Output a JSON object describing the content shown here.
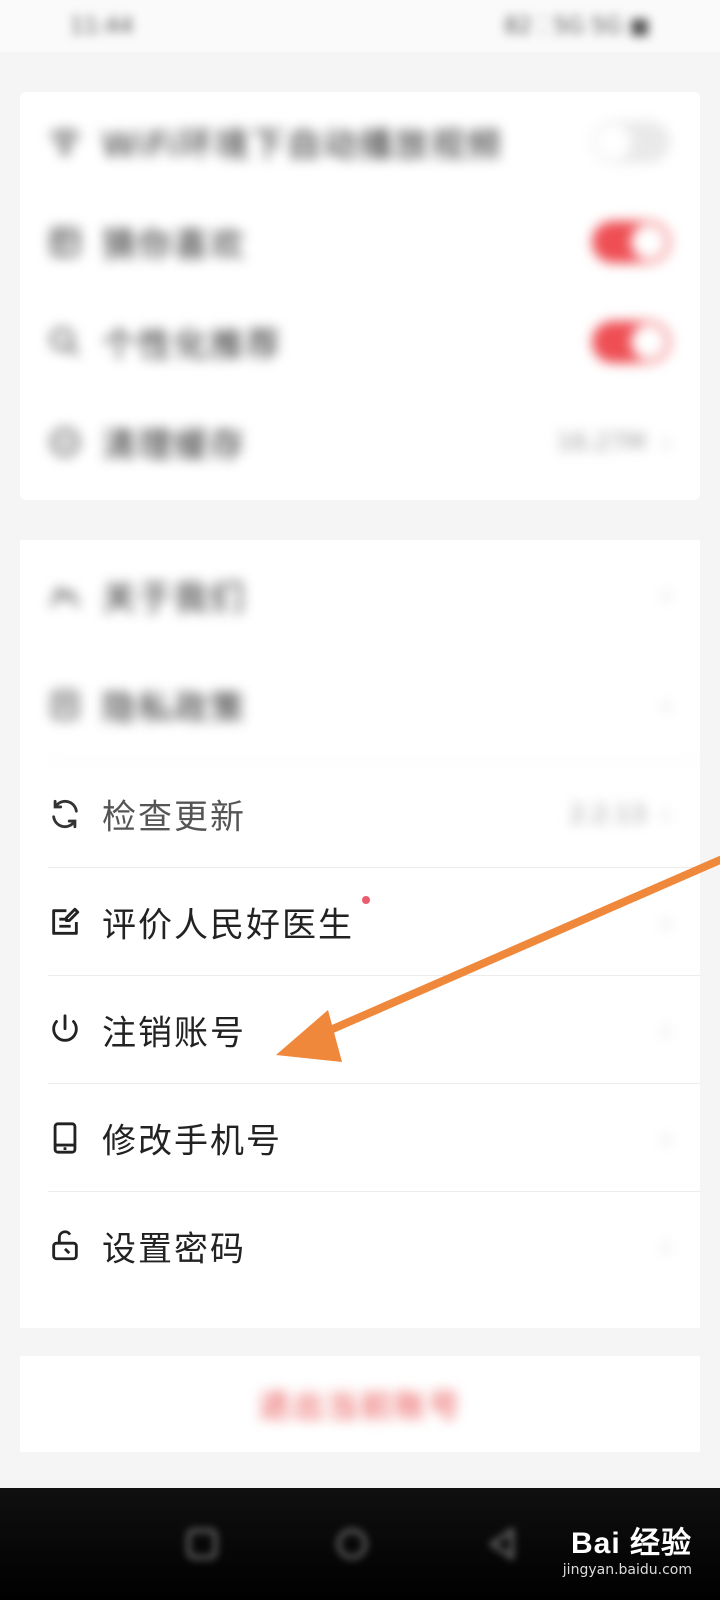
{
  "status_bar": {
    "time": "11:44",
    "right": "82 ⁚ 5G 5G ■"
  },
  "settings_group_1": {
    "items": [
      {
        "icon": "wifi-icon",
        "label": "WiFi环境下自动播放视频",
        "toggle": "off"
      },
      {
        "icon": "grid-icon",
        "label": "猜你喜欢",
        "toggle": "on"
      },
      {
        "icon": "search-icon",
        "label": "个性化推荐",
        "toggle": "on"
      },
      {
        "icon": "broom-icon",
        "label": "清理缓存",
        "value": "16.27M"
      }
    ]
  },
  "settings_group_2": {
    "items": [
      {
        "icon": "people-icon",
        "label": "关于我们"
      },
      {
        "icon": "document-icon",
        "label": "隐私政策"
      },
      {
        "icon": "refresh-icon",
        "label": "检查更新",
        "value": "2.2.13"
      },
      {
        "icon": "edit-icon",
        "label": "评价人民好医生",
        "badge": "red-dot"
      },
      {
        "icon": "power-icon",
        "label": "注销账号"
      },
      {
        "icon": "phone-icon",
        "label": "修改手机号"
      },
      {
        "icon": "lock-icon",
        "label": "设置密码"
      }
    ]
  },
  "logout": {
    "label": "退出当前账号"
  },
  "watermark": {
    "logo": "Bai 经验",
    "url": "jingyan.baidu.com"
  },
  "annotation": {
    "color": "#f0883c"
  },
  "colors": {
    "accent": "#ee4f55",
    "logout": "#e84b4b"
  }
}
